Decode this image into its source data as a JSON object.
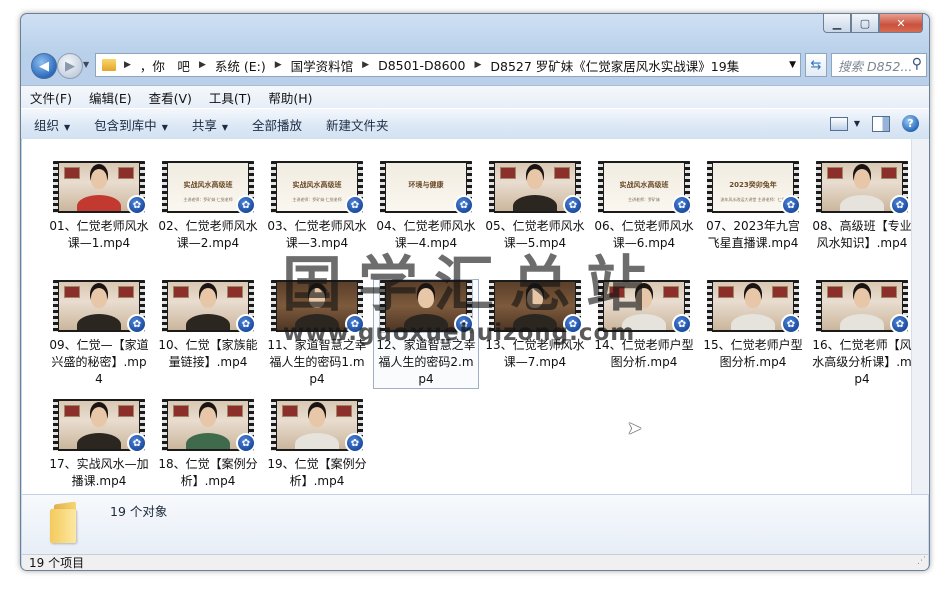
{
  "address": {
    "crumbs": [
      "，你　吧",
      "系统 (E:)",
      "国学资料馆",
      "D8501-D8600",
      "D8527 罗矿妹《仁觉家居风水实战课》19集"
    ],
    "search_placeholder": "搜索 D852..."
  },
  "menu": [
    "文件(F)",
    "编辑(E)",
    "查看(V)",
    "工具(T)",
    "帮助(H)"
  ],
  "toolbar": {
    "organize": "组织",
    "include_in_library": "包含到库中",
    "share": "共享",
    "play_all": "全部播放",
    "new_folder": "新建文件夹"
  },
  "files": [
    {
      "name": "01、仁觉老师风水课—1.mp4",
      "thumb": "person-red"
    },
    {
      "name": "02、仁觉老师风水课—2.mp4",
      "thumb": "slide",
      "slide_title": "实战风水高级班",
      "slide_sub": "主讲老师：罗矿妹  仁觉老师"
    },
    {
      "name": "03、仁觉老师风水课—3.mp4",
      "thumb": "slide",
      "slide_title": "实战风水高级班",
      "slide_sub": "主讲老师：罗矿妹  仁觉老师"
    },
    {
      "name": "04、仁觉老师风水课—4.mp4",
      "thumb": "slide",
      "slide_title": "环境与健康",
      "slide_sub": ""
    },
    {
      "name": "05、仁觉老师风水课—5.mp4",
      "thumb": "person"
    },
    {
      "name": "06、仁觉老师风水课—6.mp4",
      "thumb": "slide",
      "slide_title": "实战风水高级班",
      "slide_sub": "主讲老师：罗矿妹"
    },
    {
      "name": "07、2023年九宫飞星直播课.mp4",
      "thumb": "slide",
      "slide_title": "2023癸卯兔年",
      "slide_sub": "流年风水改运大讲堂  主讲老师：仁觉"
    },
    {
      "name": "08、高级班【专业风水知识】.mp4",
      "thumb": "person-white"
    },
    {
      "name": "09、仁觉—【家道兴盛的秘密】.mp4",
      "thumb": "person"
    },
    {
      "name": "10、仁觉【家族能量链接】.mp4",
      "thumb": "person"
    },
    {
      "name": "11、家道智慧之幸福人生的密码1.mp4",
      "thumb": "book"
    },
    {
      "name": "12、家道智慧之幸福人生的密码2.mp4",
      "thumb": "book",
      "selected": true
    },
    {
      "name": "13、仁觉老师风水课—7.mp4",
      "thumb": "book"
    },
    {
      "name": "14、仁觉老师户型图分析.mp4",
      "thumb": "person-white"
    },
    {
      "name": "15、仁觉老师户型图分析.mp4",
      "thumb": "person-white"
    },
    {
      "name": "16、仁觉老师【风水高级分析课】.mp4",
      "thumb": "person-white"
    },
    {
      "name": "17、实战风水—加播课.mp4",
      "thumb": "person"
    },
    {
      "name": "18、仁觉【案例分析】.mp4",
      "thumb": "person-green"
    },
    {
      "name": "19、仁觉【案例分析】.mp4",
      "thumb": "person-white"
    }
  ],
  "watermark": {
    "line1": "国学汇总站",
    "line2": "www.guoxuehuizong.com"
  },
  "details": {
    "object_count": "19 个对象"
  },
  "status": {
    "item_count": "19 个项目"
  }
}
